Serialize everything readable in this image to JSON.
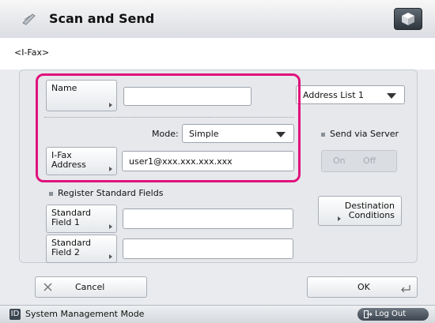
{
  "app": {
    "title": "Scan and Send",
    "icon": "scan-send-icon"
  },
  "breadcrumb": "<I-Fax>",
  "form": {
    "name_label": "Name",
    "name_value": "",
    "address_list": "Address List 1",
    "mode_label": "Mode:",
    "mode_value": "Simple",
    "ifax_label_line1": "I-Fax",
    "ifax_label_line2": "Address",
    "ifax_value": "user1@xxx.xxx.xxx.xxx",
    "send_via_server": "Send via Server",
    "toggle_on": "On",
    "toggle_off": "Off",
    "register_fields": "Register Standard Fields",
    "std1_line1": "Standard",
    "std1_line2": "Field 1",
    "std1_value": "",
    "std2_line1": "Standard",
    "std2_line2": "Field 2",
    "std2_value": "",
    "dest_line1": "Destination",
    "dest_line2": "Conditions"
  },
  "actions": {
    "cancel": "Cancel",
    "ok": "OK"
  },
  "status": {
    "mode": "System Management Mode",
    "logout": "Log Out",
    "badge": "ID"
  },
  "colors": {
    "highlight": "#e0127d"
  }
}
